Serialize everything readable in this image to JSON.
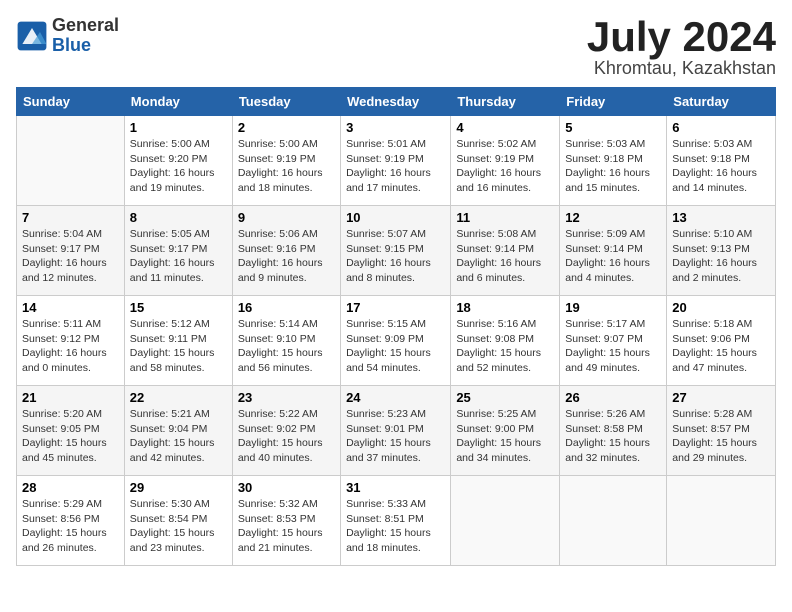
{
  "header": {
    "logo_line1": "General",
    "logo_line2": "Blue",
    "month": "July 2024",
    "location": "Khromtau, Kazakhstan"
  },
  "columns": [
    "Sunday",
    "Monday",
    "Tuesday",
    "Wednesday",
    "Thursday",
    "Friday",
    "Saturday"
  ],
  "weeks": [
    [
      {
        "day": "",
        "info": ""
      },
      {
        "day": "1",
        "info": "Sunrise: 5:00 AM\nSunset: 9:20 PM\nDaylight: 16 hours\nand 19 minutes."
      },
      {
        "day": "2",
        "info": "Sunrise: 5:00 AM\nSunset: 9:19 PM\nDaylight: 16 hours\nand 18 minutes."
      },
      {
        "day": "3",
        "info": "Sunrise: 5:01 AM\nSunset: 9:19 PM\nDaylight: 16 hours\nand 17 minutes."
      },
      {
        "day": "4",
        "info": "Sunrise: 5:02 AM\nSunset: 9:19 PM\nDaylight: 16 hours\nand 16 minutes."
      },
      {
        "day": "5",
        "info": "Sunrise: 5:03 AM\nSunset: 9:18 PM\nDaylight: 16 hours\nand 15 minutes."
      },
      {
        "day": "6",
        "info": "Sunrise: 5:03 AM\nSunset: 9:18 PM\nDaylight: 16 hours\nand 14 minutes."
      }
    ],
    [
      {
        "day": "7",
        "info": "Sunrise: 5:04 AM\nSunset: 9:17 PM\nDaylight: 16 hours\nand 12 minutes."
      },
      {
        "day": "8",
        "info": "Sunrise: 5:05 AM\nSunset: 9:17 PM\nDaylight: 16 hours\nand 11 minutes."
      },
      {
        "day": "9",
        "info": "Sunrise: 5:06 AM\nSunset: 9:16 PM\nDaylight: 16 hours\nand 9 minutes."
      },
      {
        "day": "10",
        "info": "Sunrise: 5:07 AM\nSunset: 9:15 PM\nDaylight: 16 hours\nand 8 minutes."
      },
      {
        "day": "11",
        "info": "Sunrise: 5:08 AM\nSunset: 9:14 PM\nDaylight: 16 hours\nand 6 minutes."
      },
      {
        "day": "12",
        "info": "Sunrise: 5:09 AM\nSunset: 9:14 PM\nDaylight: 16 hours\nand 4 minutes."
      },
      {
        "day": "13",
        "info": "Sunrise: 5:10 AM\nSunset: 9:13 PM\nDaylight: 16 hours\nand 2 minutes."
      }
    ],
    [
      {
        "day": "14",
        "info": "Sunrise: 5:11 AM\nSunset: 9:12 PM\nDaylight: 16 hours\nand 0 minutes."
      },
      {
        "day": "15",
        "info": "Sunrise: 5:12 AM\nSunset: 9:11 PM\nDaylight: 15 hours\nand 58 minutes."
      },
      {
        "day": "16",
        "info": "Sunrise: 5:14 AM\nSunset: 9:10 PM\nDaylight: 15 hours\nand 56 minutes."
      },
      {
        "day": "17",
        "info": "Sunrise: 5:15 AM\nSunset: 9:09 PM\nDaylight: 15 hours\nand 54 minutes."
      },
      {
        "day": "18",
        "info": "Sunrise: 5:16 AM\nSunset: 9:08 PM\nDaylight: 15 hours\nand 52 minutes."
      },
      {
        "day": "19",
        "info": "Sunrise: 5:17 AM\nSunset: 9:07 PM\nDaylight: 15 hours\nand 49 minutes."
      },
      {
        "day": "20",
        "info": "Sunrise: 5:18 AM\nSunset: 9:06 PM\nDaylight: 15 hours\nand 47 minutes."
      }
    ],
    [
      {
        "day": "21",
        "info": "Sunrise: 5:20 AM\nSunset: 9:05 PM\nDaylight: 15 hours\nand 45 minutes."
      },
      {
        "day": "22",
        "info": "Sunrise: 5:21 AM\nSunset: 9:04 PM\nDaylight: 15 hours\nand 42 minutes."
      },
      {
        "day": "23",
        "info": "Sunrise: 5:22 AM\nSunset: 9:02 PM\nDaylight: 15 hours\nand 40 minutes."
      },
      {
        "day": "24",
        "info": "Sunrise: 5:23 AM\nSunset: 9:01 PM\nDaylight: 15 hours\nand 37 minutes."
      },
      {
        "day": "25",
        "info": "Sunrise: 5:25 AM\nSunset: 9:00 PM\nDaylight: 15 hours\nand 34 minutes."
      },
      {
        "day": "26",
        "info": "Sunrise: 5:26 AM\nSunset: 8:58 PM\nDaylight: 15 hours\nand 32 minutes."
      },
      {
        "day": "27",
        "info": "Sunrise: 5:28 AM\nSunset: 8:57 PM\nDaylight: 15 hours\nand 29 minutes."
      }
    ],
    [
      {
        "day": "28",
        "info": "Sunrise: 5:29 AM\nSunset: 8:56 PM\nDaylight: 15 hours\nand 26 minutes."
      },
      {
        "day": "29",
        "info": "Sunrise: 5:30 AM\nSunset: 8:54 PM\nDaylight: 15 hours\nand 23 minutes."
      },
      {
        "day": "30",
        "info": "Sunrise: 5:32 AM\nSunset: 8:53 PM\nDaylight: 15 hours\nand 21 minutes."
      },
      {
        "day": "31",
        "info": "Sunrise: 5:33 AM\nSunset: 8:51 PM\nDaylight: 15 hours\nand 18 minutes."
      },
      {
        "day": "",
        "info": ""
      },
      {
        "day": "",
        "info": ""
      },
      {
        "day": "",
        "info": ""
      }
    ]
  ]
}
